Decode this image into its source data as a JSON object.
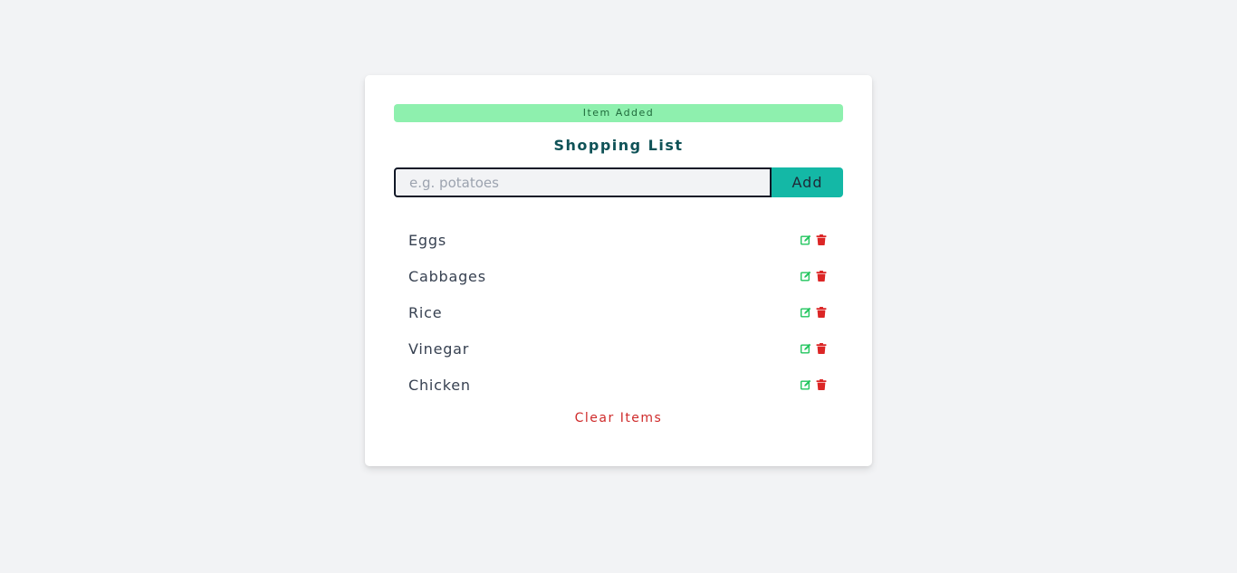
{
  "alert": {
    "text": "Item Added",
    "color": "#8ef0ae"
  },
  "title": "Shopping List",
  "form": {
    "input_value": "",
    "placeholder": "e.g. potatoes",
    "submit_label": "Add",
    "accent_color": "#14b8a6"
  },
  "items": [
    {
      "name": "Eggs",
      "edit_icon": "edit-icon",
      "delete_icon": "trash-icon"
    },
    {
      "name": "Cabbages",
      "edit_icon": "edit-icon",
      "delete_icon": "trash-icon"
    },
    {
      "name": "Rice",
      "edit_icon": "edit-icon",
      "delete_icon": "trash-icon"
    },
    {
      "name": "Vinegar",
      "edit_icon": "edit-icon",
      "delete_icon": "trash-icon"
    },
    {
      "name": "Chicken",
      "edit_icon": "edit-icon",
      "delete_icon": "trash-icon"
    }
  ],
  "clear_label": "Clear Items",
  "colors": {
    "edit": "#22c55e",
    "delete": "#dc2626",
    "clear": "#cf2b2b",
    "title": "#0f5257"
  }
}
